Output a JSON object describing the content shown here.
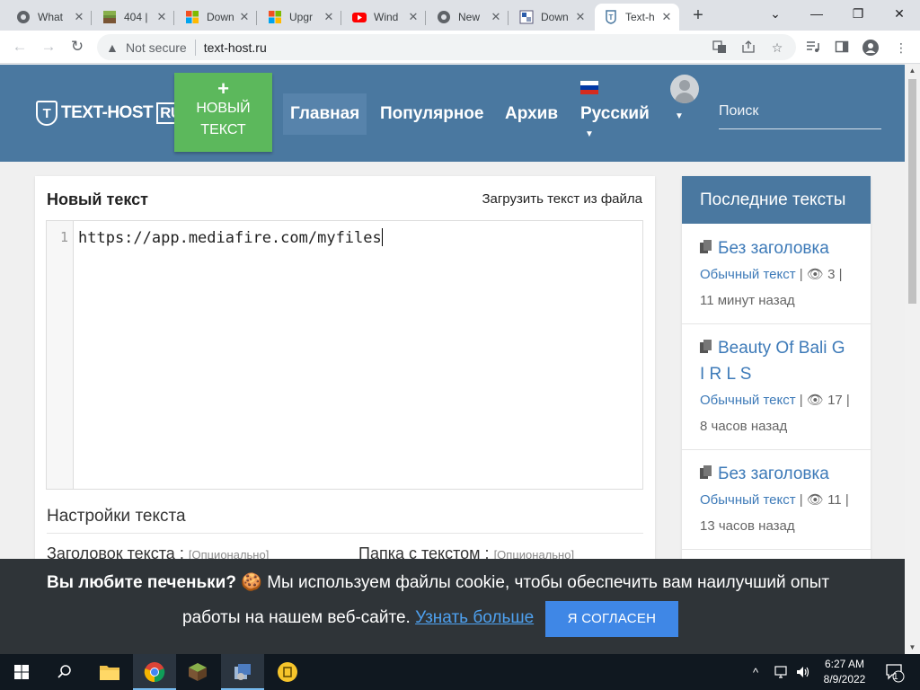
{
  "browser": {
    "tabs": [
      {
        "label": "What",
        "icon": "chrome-icon"
      },
      {
        "label": "404 |",
        "icon": "minecraft-icon"
      },
      {
        "label": "Down",
        "icon": "windows-icon"
      },
      {
        "label": "Upgr",
        "icon": "windows-icon"
      },
      {
        "label": "Wind",
        "icon": "youtube-icon"
      },
      {
        "label": "New",
        "icon": "chrome-icon"
      },
      {
        "label": "Down",
        "icon": "download-icon"
      },
      {
        "label": "Text-h",
        "icon": "texthost-icon"
      }
    ],
    "new_tab": "+",
    "controls": {
      "minimize": "—",
      "maximize": "❐",
      "close": "✕",
      "tab_search": "⌄"
    },
    "security_label": "Not secure",
    "url": "text-host.ru"
  },
  "site": {
    "logo_text": "TEXT-HOST",
    "logo_suffix": "RU",
    "logo_mark": "T",
    "new_button_plus": "+",
    "new_button_line1": "НОВЫЙ",
    "new_button_line2": "ТЕКСТ",
    "nav": [
      "Главная",
      "Популярное",
      "Архив",
      "Русский"
    ],
    "search_placeholder": "Поиск",
    "flag_colors": [
      "#ffffff",
      "#0039a6",
      "#d52b1e"
    ]
  },
  "editor": {
    "title": "Новый текст",
    "upload_link": "Загрузить текст из файла",
    "line_number": "1",
    "content": "https://app.mediafire.com/myfiles",
    "settings_title": "Настройки текста",
    "field_title_label": "Заголовок текста :",
    "field_folder_label": "Папка с текстом :",
    "optional": "[Опционально]"
  },
  "sidebar": {
    "title": "Последние тексты",
    "posts": [
      {
        "title": "Без заголовка",
        "type": "Обычный текст",
        "views": "3",
        "time": "11 минут назад"
      },
      {
        "title": "Beauty Of Bali G I R L S",
        "type": "Обычный текст",
        "views": "17",
        "time": "8 часов назад"
      },
      {
        "title": "Без заголовка",
        "type": "Обычный текст",
        "views": "11",
        "time": "13 часов назад"
      }
    ]
  },
  "cookie": {
    "question": "Вы любите печеньки?",
    "emoji": "🍪",
    "text1": "Мы используем файлы cookie, чтобы обеспечить вам наилучший опыт",
    "text2": "работы на нашем веб-сайте.",
    "link": "Узнать больше",
    "button": "Я СОГЛАСЕН"
  },
  "taskbar": {
    "time": "6:27 AM",
    "date": "8/9/2022",
    "notifications": "1"
  },
  "colors": {
    "header": "#4a78a0",
    "new_button": "#5cb85c",
    "link": "#3d7ab8",
    "cookie_bg": "#2f3438",
    "cookie_button": "#3f87e6"
  }
}
